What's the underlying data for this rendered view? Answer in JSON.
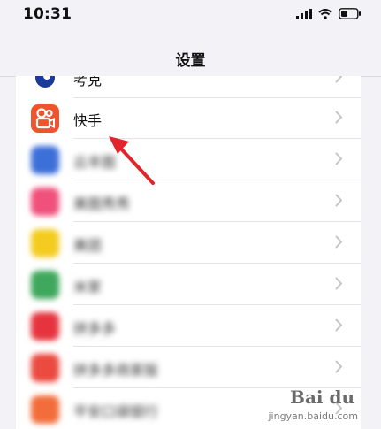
{
  "status_bar": {
    "time": "10:31",
    "icons": [
      "signal-icon",
      "wifi-icon",
      "battery-icon"
    ]
  },
  "nav": {
    "title": "设置"
  },
  "list": {
    "items": [
      {
        "label": "考克",
        "icon": "partial-app-icon",
        "color": "#1a3a9a",
        "blurred": false
      },
      {
        "label": "快手",
        "icon": "kuaishou-app-icon",
        "color": "#f0542d",
        "blurred": false
      },
      {
        "label": "云丰图",
        "icon": "blurred-app-icon",
        "color": "#3d6fd8",
        "blurred": true
      },
      {
        "label": "美图秀秀",
        "icon": "blurred-app-icon",
        "color": "#f0517c",
        "blurred": true
      },
      {
        "label": "美团",
        "icon": "blurred-app-icon",
        "color": "#f4cc1f",
        "blurred": true
      },
      {
        "label": "米家",
        "icon": "blurred-app-icon",
        "color": "#3fa85d",
        "blurred": true
      },
      {
        "label": "拼多多",
        "icon": "blurred-app-icon",
        "color": "#e6343f",
        "blurred": true
      },
      {
        "label": "拼多多商家版",
        "icon": "blurred-app-icon",
        "color": "#ea4a3f",
        "blurred": true
      },
      {
        "label": "平安口袋银行",
        "icon": "blurred-app-icon",
        "color": "#f26d3b",
        "blurred": true
      }
    ]
  },
  "watermark": {
    "logo": "Bai du",
    "sub": "jingyan.baidu.com"
  }
}
